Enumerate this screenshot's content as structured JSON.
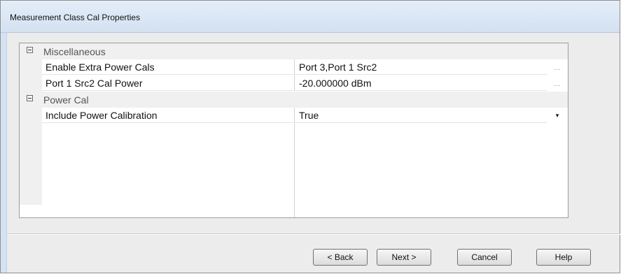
{
  "window": {
    "title": "Measurement Class Cal Properties"
  },
  "grid": {
    "categories": [
      {
        "label": "Miscellaneous",
        "properties": [
          {
            "name": "Enable Extra Power Cals",
            "value": "Port 3,Port 1 Src2",
            "editor": "..."
          },
          {
            "name": "Port 1 Src2 Cal Power",
            "value": "-20.000000 dBm",
            "editor": "..."
          }
        ]
      },
      {
        "label": "Power Cal",
        "properties": [
          {
            "name": "Include Power Calibration",
            "value": "True",
            "editor": "▾"
          }
        ]
      }
    ]
  },
  "buttons": {
    "back": "< Back",
    "next": "Next >",
    "cancel": "Cancel",
    "help": "Help"
  }
}
